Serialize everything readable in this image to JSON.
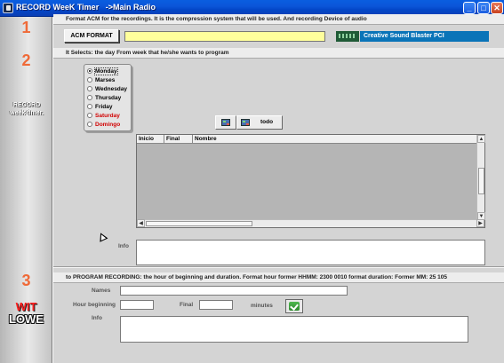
{
  "window": {
    "title": "RECORD WeeK Timer   ->Main Radio",
    "min_label": "_",
    "max_label": "□",
    "close_label": "✕"
  },
  "sidebar": {
    "step1": "1",
    "step2": "2",
    "step3": "3",
    "record_line1": "RECORD",
    "record_line2": "week timer.",
    "brand_line1": "WIT",
    "brand_line2": "LOWE"
  },
  "section1": {
    "header": "Format ACM for the recordings. It is the compression system that will be used. And recording Device of audio",
    "acm_button": "ACM FORMAT",
    "acm_value": "",
    "device_name": "Creative Sound Blaster PCI"
  },
  "section2": {
    "header": "It Selects: the day From week that he/she wants to program",
    "days": [
      {
        "label": "Monday",
        "selected": true,
        "color": "#000000"
      },
      {
        "label": "Marses",
        "selected": false,
        "color": "#000000"
      },
      {
        "label": "Wednesday",
        "selected": false,
        "color": "#000000"
      },
      {
        "label": "Thursday",
        "selected": false,
        "color": "#000000"
      },
      {
        "label": "Friday",
        "selected": false,
        "color": "#000000"
      },
      {
        "label": "Saturday",
        "selected": false,
        "color": "#d10000"
      },
      {
        "label": "Domingo",
        "selected": false,
        "color": "#d10000"
      }
    ],
    "todo_button": "todo",
    "table": {
      "columns": [
        "Inicio",
        "Final",
        "Nombre"
      ],
      "rows": []
    },
    "info_label": "Info",
    "info_value": ""
  },
  "section3": {
    "header": "to PROGRAM RECORDING: the hour of beginning and duration.  Format hour former HHMM:  2300 0010 format duration: Former MM: 25 105",
    "names_label": "Names",
    "names_value": "",
    "hour_label": "Hour beginning",
    "hour_value": "",
    "final_label": "Final",
    "final_value": "",
    "minutes_label": "minutes",
    "info_label": "Info",
    "info_value": ""
  },
  "colors": {
    "accent_orange": "#ef6a38",
    "brand_red": "#ff2020",
    "device_blue": "#0a74b8",
    "acm_field_yellow": "#ffff9c"
  }
}
